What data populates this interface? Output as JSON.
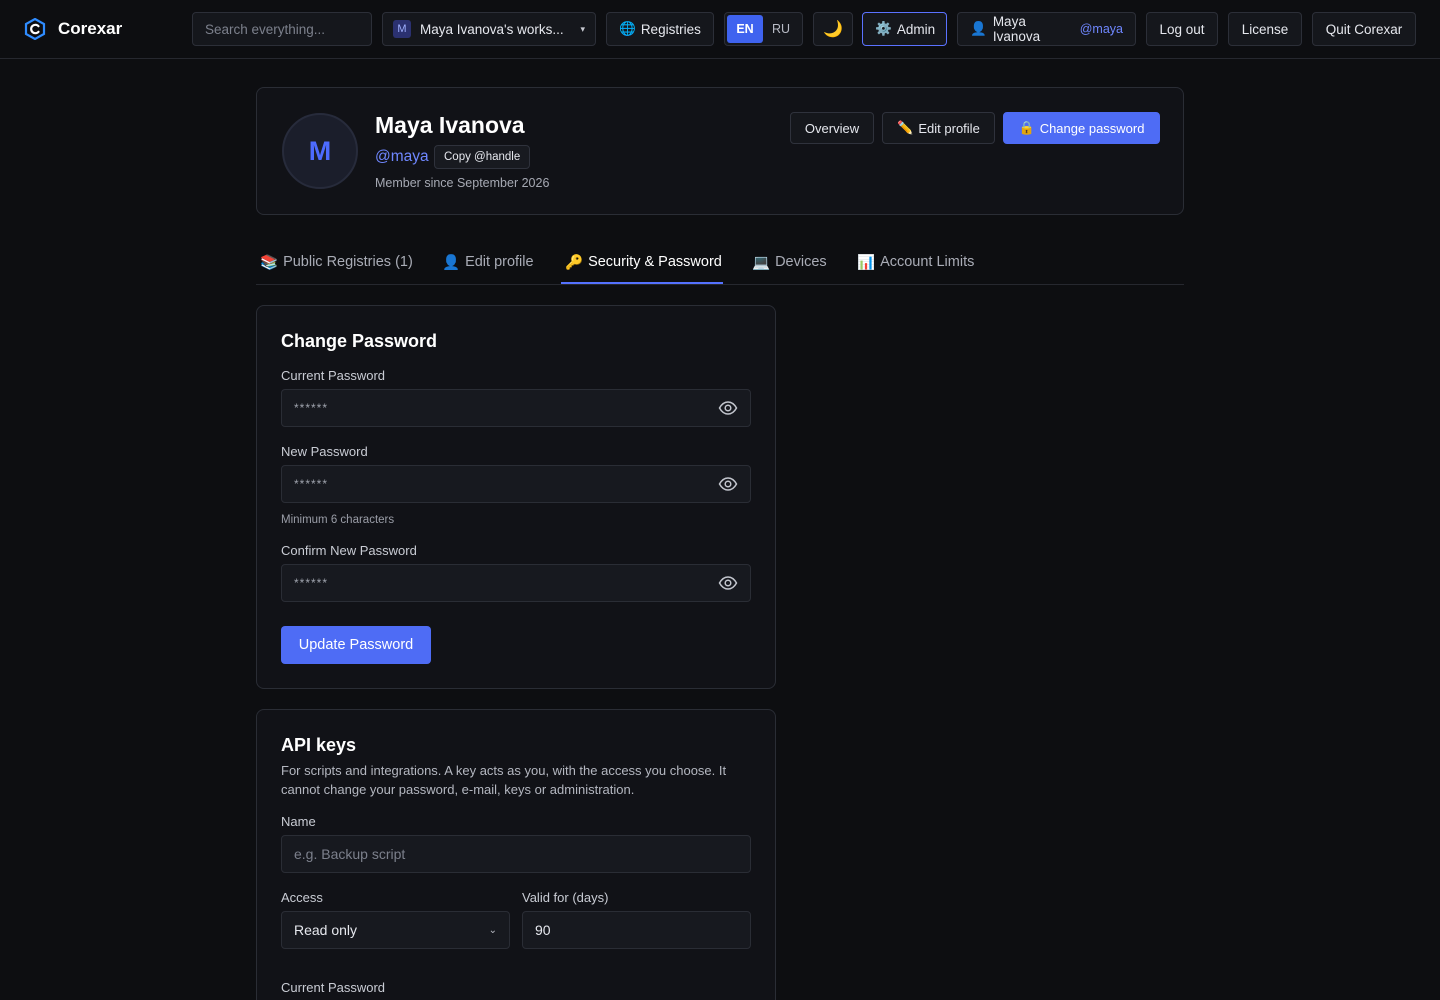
{
  "topbar": {
    "brand": "Corexar",
    "search_placeholder": "Search everything...",
    "workspace_badge": "M",
    "workspace_name": "Maya Ivanova's works...",
    "registries_label": "Registries",
    "lang_en": "EN",
    "lang_ru": "RU",
    "admin_label": "Admin",
    "user_name": "Maya Ivanova",
    "user_handle": "@maya",
    "logout_label": "Log out",
    "license_label": "License",
    "quit_label": "Quit Corexar"
  },
  "profile": {
    "initial": "M",
    "name": "Maya Ivanova",
    "handle": "@maya",
    "copy_label": "Copy @handle",
    "member_since": "Member since September 2026",
    "overview_label": "Overview",
    "edit_label": "Edit profile",
    "change_password_label": "Change password"
  },
  "tabs": [
    {
      "icon": "📚",
      "label": "Public Registries (1)"
    },
    {
      "icon": "👤",
      "label": "Edit profile"
    },
    {
      "icon": "🔑",
      "label": "Security & Password"
    },
    {
      "icon": "💻",
      "label": "Devices"
    },
    {
      "icon": "📊",
      "label": "Account Limits"
    }
  ],
  "active_tab": 2,
  "change_password": {
    "title": "Change Password",
    "current_label": "Current Password",
    "current_value": "******",
    "new_label": "New Password",
    "new_value": "******",
    "new_hint": "Minimum 6 characters",
    "confirm_label": "Confirm New Password",
    "confirm_value": "******",
    "submit_label": "Update Password"
  },
  "api_keys": {
    "title": "API keys",
    "description": "For scripts and integrations. A key acts as you, with the access you choose. It cannot change your password, e-mail, keys or administration.",
    "name_label": "Name",
    "name_placeholder": "e.g. Backup script",
    "access_label": "Access",
    "access_value": "Read only",
    "valid_label": "Valid for (days)",
    "valid_value": "90",
    "current_password_label": "Current Password"
  },
  "colors": {
    "accent": "#4e6cf5",
    "background": "#0d0e11",
    "panel": "#111217",
    "handle": "#6f87ff"
  }
}
